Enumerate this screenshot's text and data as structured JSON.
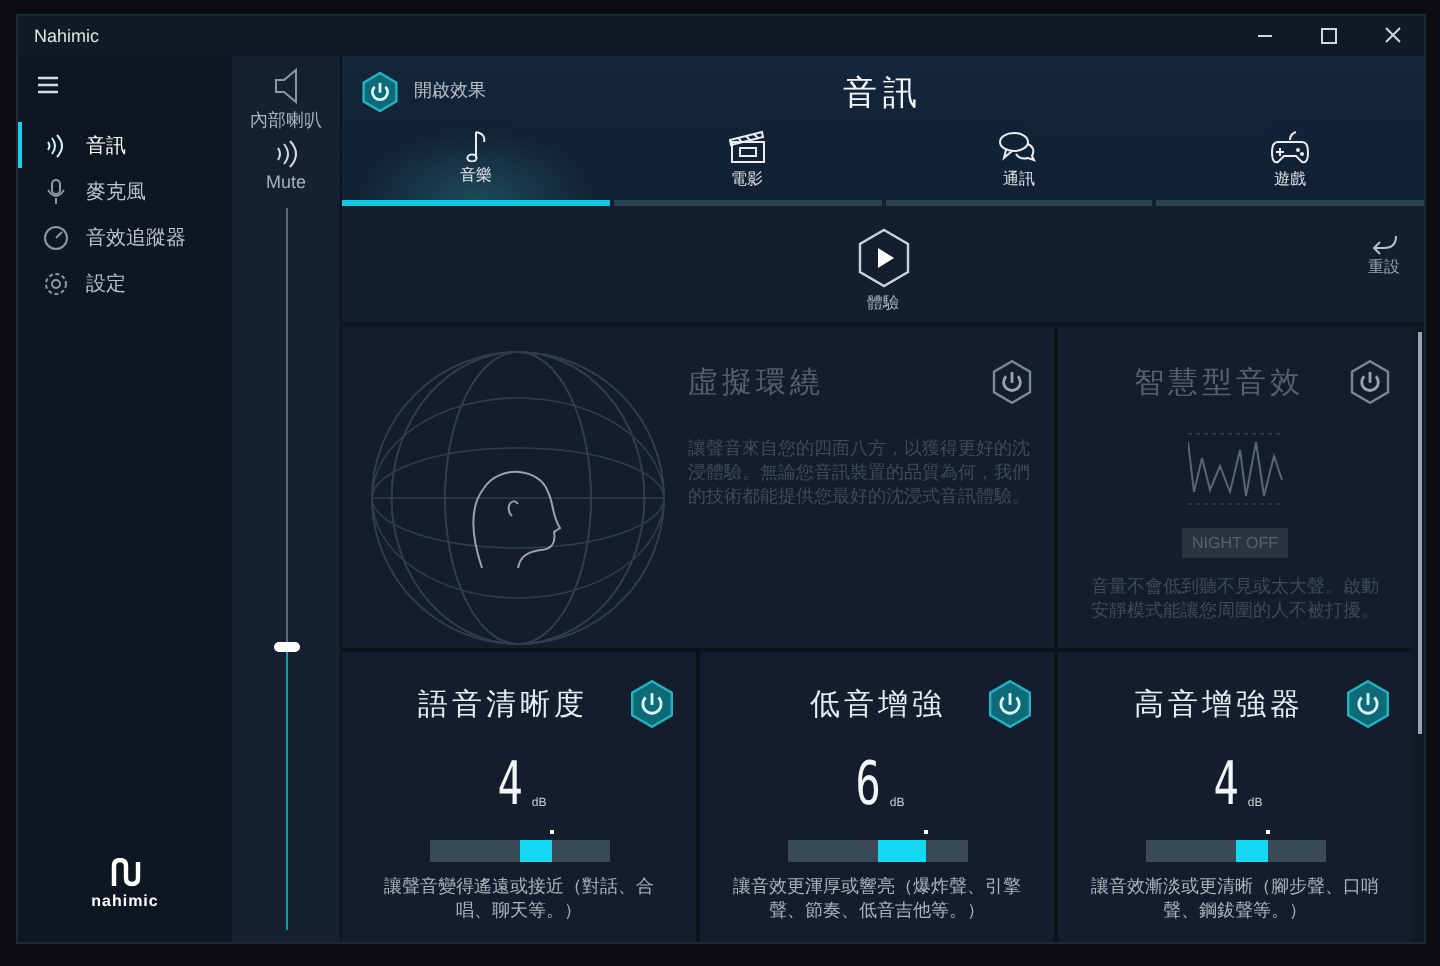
{
  "window": {
    "title": "Nahimic"
  },
  "sidebar": {
    "items": [
      {
        "label": "音訊",
        "selected": true
      },
      {
        "label": "麥克風",
        "selected": false
      },
      {
        "label": "音效追蹤器",
        "selected": false
      },
      {
        "label": "設定",
        "selected": false
      }
    ],
    "logo": "nahimic"
  },
  "output": {
    "device": "內部喇叭",
    "mute_label": "Mute",
    "volume": {
      "level": 0.39
    }
  },
  "header": {
    "effects_toggle": {
      "label": "開啟效果",
      "on": true
    },
    "title": "音訊"
  },
  "tabs": [
    {
      "label": "音樂",
      "selected": true
    },
    {
      "label": "電影",
      "selected": false
    },
    {
      "label": "通訊",
      "selected": false
    },
    {
      "label": "遊戲",
      "selected": false
    }
  ],
  "preview": {
    "label": "體驗"
  },
  "reset": {
    "label": "重設"
  },
  "effects": [
    {
      "kind": "surround",
      "title": "虛擬環繞",
      "on": false,
      "description": "讓聲音來自您的四面八方，以獲得更好的沈浸體驗。無論您音訊裝置的品質為何，我們的技術都能提供您最好的沈浸式音訊體驗。"
    },
    {
      "kind": "night",
      "title": "智慧型音效",
      "on": false,
      "button": "NIGHT OFF",
      "description": "音量不會低到聽不見或太大聲。啟動安靜模式能讓您周圍的人不被打擾。"
    },
    {
      "kind": "gain",
      "title": "語音清晰度",
      "on": true,
      "value": "4",
      "unit": "dB",
      "level": 0.68,
      "description": "讓聲音變得遙遠或接近（對話、合唱、聊天等。）"
    },
    {
      "kind": "gain",
      "title": "低音增強",
      "on": true,
      "value": "6",
      "unit": "dB",
      "level": 0.77,
      "description": "讓音效更渾厚或響亮（爆炸聲、引擎聲、節奏、低音吉他等。）"
    },
    {
      "kind": "gain",
      "title": "高音增強器",
      "on": true,
      "value": "4",
      "unit": "dB",
      "level": 0.68,
      "description": "讓音效漸淡或更清晰（腳步聲、口哨聲、鋼鈸聲等。）"
    }
  ]
}
